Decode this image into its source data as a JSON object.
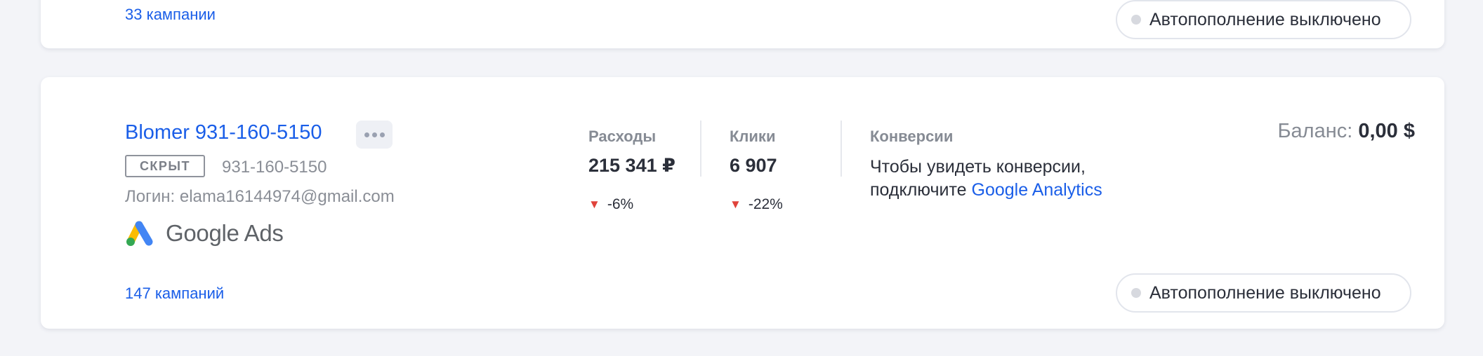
{
  "cards": [
    {
      "campaigns_link": "33 кампании",
      "autofill_status": "Автопополнение выключено"
    },
    {
      "account_name": "Blomer 931-160-5150",
      "hidden_badge": "СКРЫТ",
      "account_id": "931-160-5150",
      "login": "Логин: elama16144974@gmail.com",
      "platform": "Google Ads",
      "metrics": [
        {
          "label": "Расходы",
          "value": "215 341 ₽",
          "change": "-6%",
          "trend": "down"
        },
        {
          "label": "Клики",
          "value": "6 907",
          "change": "-22%",
          "trend": "down"
        },
        {
          "label": "Конверсии",
          "text": "Чтобы увидеть конверсии, подключите",
          "link": "Google Analytics"
        }
      ],
      "balance_label": "Баланс:",
      "balance_value": "0,00 $",
      "campaigns_link": "147 кампаний",
      "autofill_status": "Автопополнение выключено"
    }
  ],
  "colors": {
    "link": "#1a5ee8",
    "negative_trend": "#e0433b",
    "background": "#f3f4f8"
  }
}
